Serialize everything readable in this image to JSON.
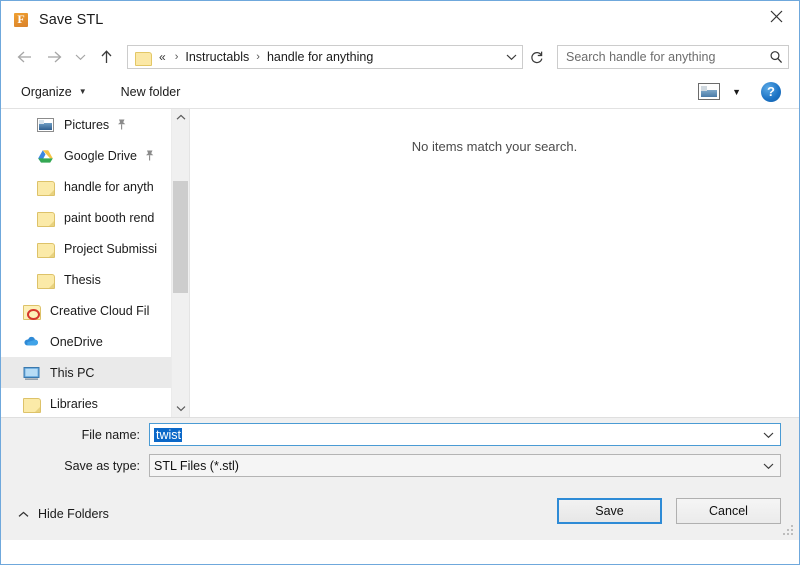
{
  "window": {
    "title": "Save STL",
    "app_icon": "fusion-f-icon",
    "close_label": "×"
  },
  "nav": {
    "back_label": "←",
    "forward_label": "→",
    "recent_label": "⌄",
    "up_label": "↑",
    "refresh_label": "↻",
    "address_dropdown_label": "⌄",
    "breadcrumb_ellipsis": "«",
    "breadcrumbs": [
      {
        "label": "Instructabls"
      },
      {
        "label": "handle for anything"
      }
    ],
    "separator": "›"
  },
  "search": {
    "placeholder": "Search handle for anything",
    "icon": "search-icon"
  },
  "toolbar": {
    "organize_label": "Organize",
    "organize_caret": "▼",
    "new_folder_label": "New folder",
    "view_icon": "view-layout-icon",
    "view_caret": "▼",
    "help_label": "?"
  },
  "sidebar": {
    "items": [
      {
        "label": "Pictures",
        "icon": "pictures-icon",
        "pinned": true,
        "selected": false
      },
      {
        "label": "Google Drive",
        "icon": "google-drive-icon",
        "pinned": true,
        "selected": false
      },
      {
        "label": "handle for anyth",
        "icon": "folder-icon",
        "pinned": false,
        "selected": false
      },
      {
        "label": "paint booth rend",
        "icon": "folder-icon",
        "pinned": false,
        "selected": false
      },
      {
        "label": "Project Submissi",
        "icon": "folder-icon",
        "pinned": false,
        "selected": false
      },
      {
        "label": "Thesis",
        "icon": "folder-icon",
        "pinned": false,
        "selected": false
      },
      {
        "label": "Creative Cloud Fil",
        "icon": "creative-cloud-icon",
        "pinned": false,
        "selected": false
      },
      {
        "label": "OneDrive",
        "icon": "onedrive-icon",
        "pinned": false,
        "selected": false
      },
      {
        "label": "This PC",
        "icon": "this-pc-icon",
        "pinned": false,
        "selected": true
      },
      {
        "label": "Libraries",
        "icon": "libraries-icon",
        "pinned": false,
        "selected": false
      }
    ],
    "scroll_up_label": "⌃",
    "scroll_down_label": "⌄"
  },
  "filelist": {
    "empty_message": "No items match your search."
  },
  "form": {
    "filename_label": "File name:",
    "filename_value": "twist",
    "filename_selected": true,
    "filetype_label": "Save as type:",
    "filetype_value": "STL Files (*.stl)",
    "dropdown_caret": "⌄"
  },
  "footer": {
    "hide_folders_label": "Hide Folders",
    "hide_folders_caret": "⌃",
    "save_label": "Save",
    "cancel_label": "Cancel"
  },
  "colors": {
    "accent": "#2e8bd6",
    "selection": "#0b68c8",
    "dialog_border": "#6fa8dc",
    "panel_bg": "#f0f0f0",
    "folder_yellow": "#fbeaa8"
  }
}
